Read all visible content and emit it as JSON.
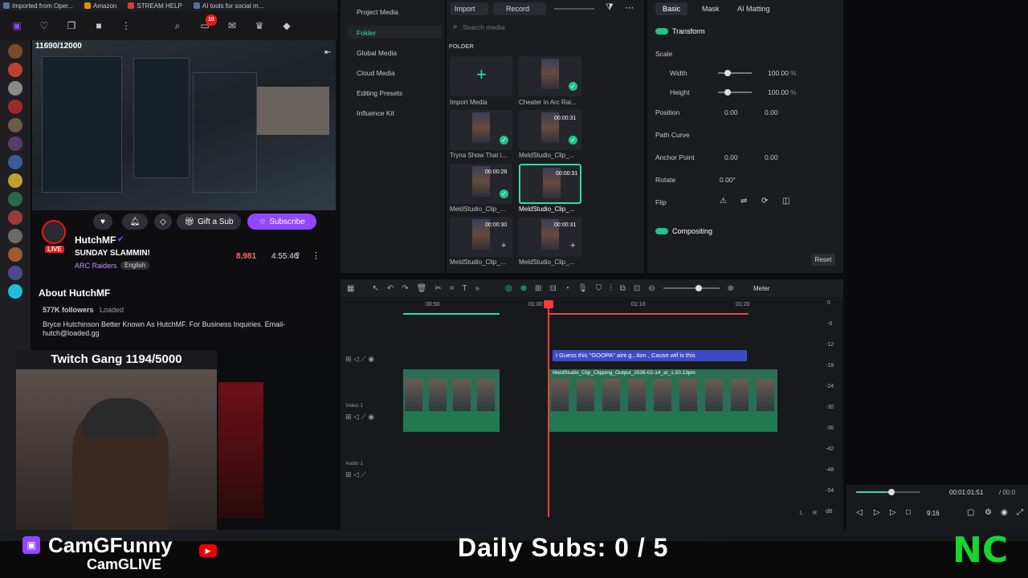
{
  "browser": {
    "bookmarks": [
      "Imported from Oper...",
      "Amazon",
      "STREAM HELP",
      "AI tools for social m..."
    ],
    "notif_count": "10"
  },
  "twitch": {
    "stream_counter": "11690/12000",
    "channel_name": "HutchMF",
    "live_badge": "LIVE",
    "stream_title": "SUNDAY SLAMMIN!",
    "game": "ARC Raiders",
    "language": "English",
    "gift_button": "Gift a Sub",
    "subscribe_button": "Subscribe",
    "viewers": "8,981",
    "uptime": "4:55:46",
    "about_title": "About HutchMF",
    "followers": "577K followers",
    "team": "Loaded",
    "bio": "Bryce Hutchinson Better Known As HutchMF. For Business Inquiries. Email- hutch@loaded.gg",
    "webcam_label": "Twitch Gang 1194/5000"
  },
  "editor": {
    "left_nav": {
      "items": [
        "Project Media",
        "Folder",
        "Global Media",
        "Cloud Media",
        "Editing Presets",
        "Influence Kit"
      ]
    },
    "media": {
      "import_label": "Import",
      "record_label": "Record",
      "search_placeholder": "Search media",
      "folder_label": "FOLDER",
      "items": [
        {
          "label": "Import Media",
          "duration": ""
        },
        {
          "label": "Cheater in Arc Rai...",
          "duration": ""
        },
        {
          "label": "Tryna Show That i...",
          "duration": ""
        },
        {
          "label": "MeldStudio_Clip_...",
          "duration": "00:00:31"
        },
        {
          "label": "MeldStudio_Clip_...",
          "duration": "00:00:28"
        },
        {
          "label": "MeldStudio_Clip_...",
          "duration": "00:00:31"
        },
        {
          "label": "MeldStudio_Clip_...",
          "duration": "00:00:30"
        },
        {
          "label": "MeldStudio_Clip_...",
          "duration": "00:00:31"
        }
      ]
    },
    "props": {
      "tabs": [
        "Basic",
        "Mask",
        "AI Matting"
      ],
      "transform": "Transform",
      "scale": "Scale",
      "width_label": "Width",
      "width_val": "100.00",
      "height_label": "Height",
      "height_val": "100.00",
      "pct": "%",
      "position": "Position",
      "pos_x": "0.00",
      "pos_y": "0.00",
      "path_curve": "Path Curve",
      "anchor": "Anchor Point",
      "anchor_x": "0.00",
      "anchor_y": "0.00",
      "rotate": "Rotate",
      "rotate_val": "0.00°",
      "flip": "Flip",
      "compositing": "Compositing",
      "reset": "Reset"
    },
    "timeline": {
      "meter_label": "Meter",
      "ruler": [
        "00:50",
        "01:00",
        "01:10",
        "01:20"
      ],
      "text_clip": "I Guess this \"GOOPA\" aint g...tion , Cause wtf is this",
      "video_clip": "MeldStudio_Clip_Clipping_Output_2026-02-14_at_1.50.13pm",
      "track_video": "Video 1",
      "track_audio": "Audio 1",
      "meter_ticks": [
        "0",
        "-6",
        "-12",
        "-18",
        "-24",
        "-30",
        "-36",
        "-42",
        "-48",
        "-54",
        "dB"
      ],
      "lr": [
        "L",
        "R"
      ]
    },
    "preview": {
      "timecode": "00:01:01:51",
      "total": "/ 00:0",
      "ratio": "9:16"
    }
  },
  "overlay": {
    "daily_subs": "Daily Subs: 0 / 5",
    "cam_name": "CamGFunny",
    "cam_handle": "CamGLIVE",
    "logo": "NC"
  },
  "colors": {
    "accent": "#1fc48a",
    "twitch": "#9147ff",
    "playhead": "#ff3a3a",
    "brand_green": "#19d62e"
  }
}
